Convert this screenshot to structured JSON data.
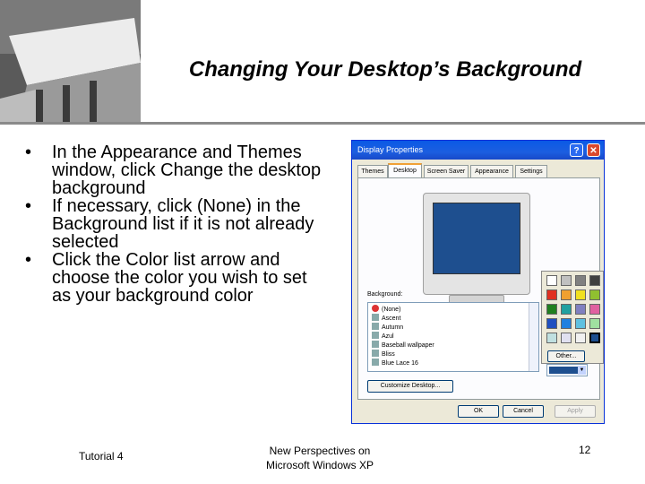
{
  "slide": {
    "title": "Changing Your Desktop’s Background",
    "bullets": [
      "In the Appearance and Themes window, click Change the desktop background",
      "If necessary, click (None) in the Background list if it is not already selected",
      "Click the Color list arrow and choose the color you wish to set as your background color"
    ],
    "bullet_glyph": "•",
    "footer": {
      "left": "Tutorial 4",
      "center_line1": "New Perspectives on",
      "center_line2": "Microsoft Windows XP",
      "page": "12"
    }
  },
  "dialog": {
    "title": "Display Properties",
    "help_glyph": "?",
    "close_glyph": "✕",
    "tabs": [
      "Themes",
      "Desktop",
      "Screen Saver",
      "Appearance",
      "Settings"
    ],
    "active_tab": "Desktop",
    "background_label": "Background:",
    "background_items": [
      "(None)",
      "Ascent",
      "Autumn",
      "Azul",
      "Baseball wallpaper",
      "Bliss",
      "Blue Lace 16"
    ],
    "selected_item": "(None)",
    "customize_button": "Customize Desktop...",
    "other_button": "Other...",
    "ok_button": "OK",
    "cancel_button": "Cancel",
    "apply_button": "Apply",
    "selected_color": "#1e4f8f",
    "palette_colors": [
      "#ffffff",
      "#c0c0c0",
      "#808080",
      "#404040",
      "#e03020",
      "#f0a030",
      "#f0e020",
      "#90c030",
      "#208020",
      "#20a0a0",
      "#8080c0",
      "#e060a0",
      "#2050c0",
      "#2080e0",
      "#60c0e0",
      "#a0e0a0",
      "#c0e0e0",
      "#e0e0f0",
      "#f0f0f0",
      "#1e4f8f"
    ]
  }
}
